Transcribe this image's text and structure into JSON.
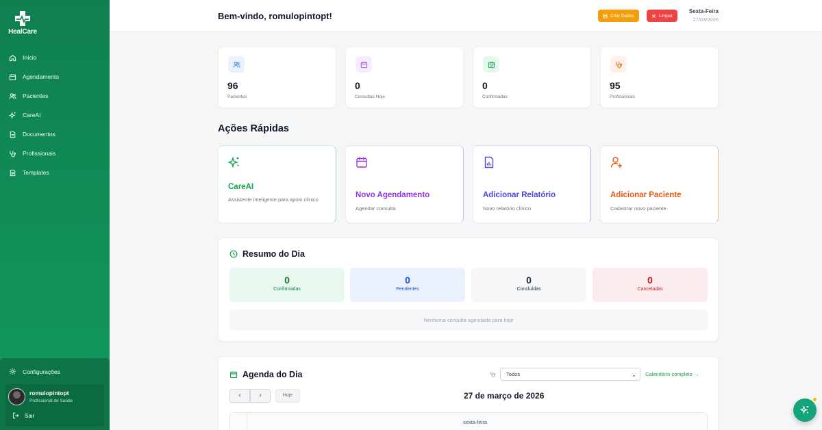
{
  "app": {
    "name": "HealCare"
  },
  "sidebar": {
    "items": [
      {
        "label": "Início",
        "icon": "home-icon"
      },
      {
        "label": "Agendamento",
        "icon": "calendar-icon"
      },
      {
        "label": "Pacientes",
        "icon": "users-icon"
      },
      {
        "label": "CareAI",
        "icon": "sparkles-icon"
      },
      {
        "label": "Documentos",
        "icon": "document-icon"
      },
      {
        "label": "Profissionais",
        "icon": "stethoscope-icon"
      },
      {
        "label": "Templates",
        "icon": "template-icon"
      }
    ],
    "settings_label": "Configurações",
    "user": {
      "name": "romulopintopt",
      "role": "Profissional de Saúde"
    },
    "logout_label": "Sair"
  },
  "header": {
    "welcome": "Bem-vindo, romulopintopt!",
    "create_button": "Criar Dados",
    "clear_button": "Limpar",
    "weekday": "Sexta-Feira",
    "date": "27/03/2026"
  },
  "stats": [
    {
      "value": "96",
      "label": "Pacientes",
      "icon": "users-icon",
      "color": "#3b82f6",
      "bg": "#eaf2fe"
    },
    {
      "value": "0",
      "label": "Consultas Hoje",
      "icon": "calendar-icon",
      "color": "#a855f7",
      "bg": "#f5ecfe"
    },
    {
      "value": "0",
      "label": "Confirmadas",
      "icon": "calendar-check-icon",
      "color": "#16a34a",
      "bg": "#e7f8ee"
    },
    {
      "value": "95",
      "label": "Profissionais",
      "icon": "stethoscope-icon",
      "color": "#ea580c",
      "bg": "#fdf0e6"
    }
  ],
  "quick_actions": {
    "title": "Ações Rápidas",
    "items": [
      {
        "title": "CareAI",
        "desc": "Assistente inteligente para apoio clínico",
        "icon": "sparkles-icon",
        "color": "#16a34a"
      },
      {
        "title": "Novo Agendamento",
        "desc": "Agendar consulta",
        "icon": "calendar-icon",
        "color": "#9333ea"
      },
      {
        "title": "Adicionar Relatório",
        "desc": "Novo relatório clínico",
        "icon": "report-icon",
        "color": "#4f46e5"
      },
      {
        "title": "Adicionar Paciente",
        "desc": "Cadastrar novo paciente",
        "icon": "user-plus-icon",
        "color": "#ea580c"
      }
    ]
  },
  "resumo": {
    "title": "Resumo do Dia",
    "boxes": [
      {
        "value": "0",
        "label": "Confirmadas",
        "color": "#15803d",
        "bg": "#e8f8ef"
      },
      {
        "value": "0",
        "label": "Pendentes",
        "color": "#1d4ed8",
        "bg": "#e9f2fe"
      },
      {
        "value": "0",
        "label": "Concluídas",
        "color": "#1f2937",
        "bg": "#f4f6f8"
      },
      {
        "value": "0",
        "label": "Canceladas",
        "color": "#b91c1c",
        "bg": "#fdeced"
      }
    ],
    "empty": "Nenhuma consulta agendada para hoje"
  },
  "agenda": {
    "title": "Agenda do Dia",
    "filter_value": "Todos",
    "calendar_link": "Calendário completo →",
    "prev": "‹",
    "next": "›",
    "today": "Hoje",
    "date_title": "27 de março de 2026",
    "day_header": "sexta-feira"
  }
}
